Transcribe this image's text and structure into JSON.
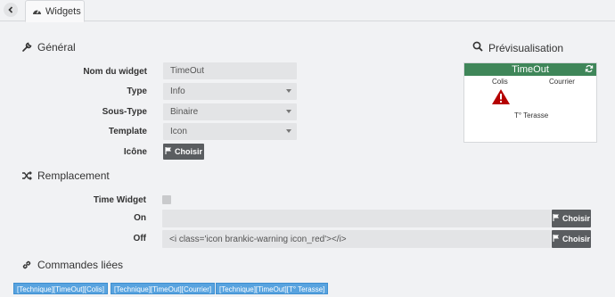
{
  "topbar": {
    "back_icon": "chevron-left-icon",
    "tab_icon": "dashboard-icon",
    "tab_label": "Widgets"
  },
  "general": {
    "title": "Général",
    "icon": "wrench-icon",
    "rows": {
      "name_label": "Nom du widget",
      "name_value": "TimeOut",
      "type_label": "Type",
      "type_value": "Info",
      "subtype_label": "Sous-Type",
      "subtype_value": "Binaire",
      "template_label": "Template",
      "template_value": "Icon",
      "icon_label": "Icône",
      "choose_label": "Choisir"
    }
  },
  "preview": {
    "title": "Prévisualisation",
    "icon": "search-icon",
    "widget_title": "TimeOut",
    "item1": "Colis",
    "item2": "Courrier",
    "item3": "T° Terasse",
    "accent": "#3f8659",
    "warning_color": "#b50000"
  },
  "replacement": {
    "title": "Remplacement",
    "icon": "shuffle-icon",
    "time_widget_label": "Time Widget",
    "on_label": "On",
    "on_value": "",
    "off_label": "Off",
    "off_value": "<i class='icon brankic-warning icon_red'></i>",
    "choose_label": "Choisir"
  },
  "linked": {
    "title": "Commandes liées",
    "icon": "link-icon",
    "tags": [
      "[Technique][TimeOut][Colis]",
      "[Technique][TimeOut][Courrier]",
      "[Technique][TimeOut][T° Terasse]"
    ],
    "tag_color": "#58a3df"
  }
}
